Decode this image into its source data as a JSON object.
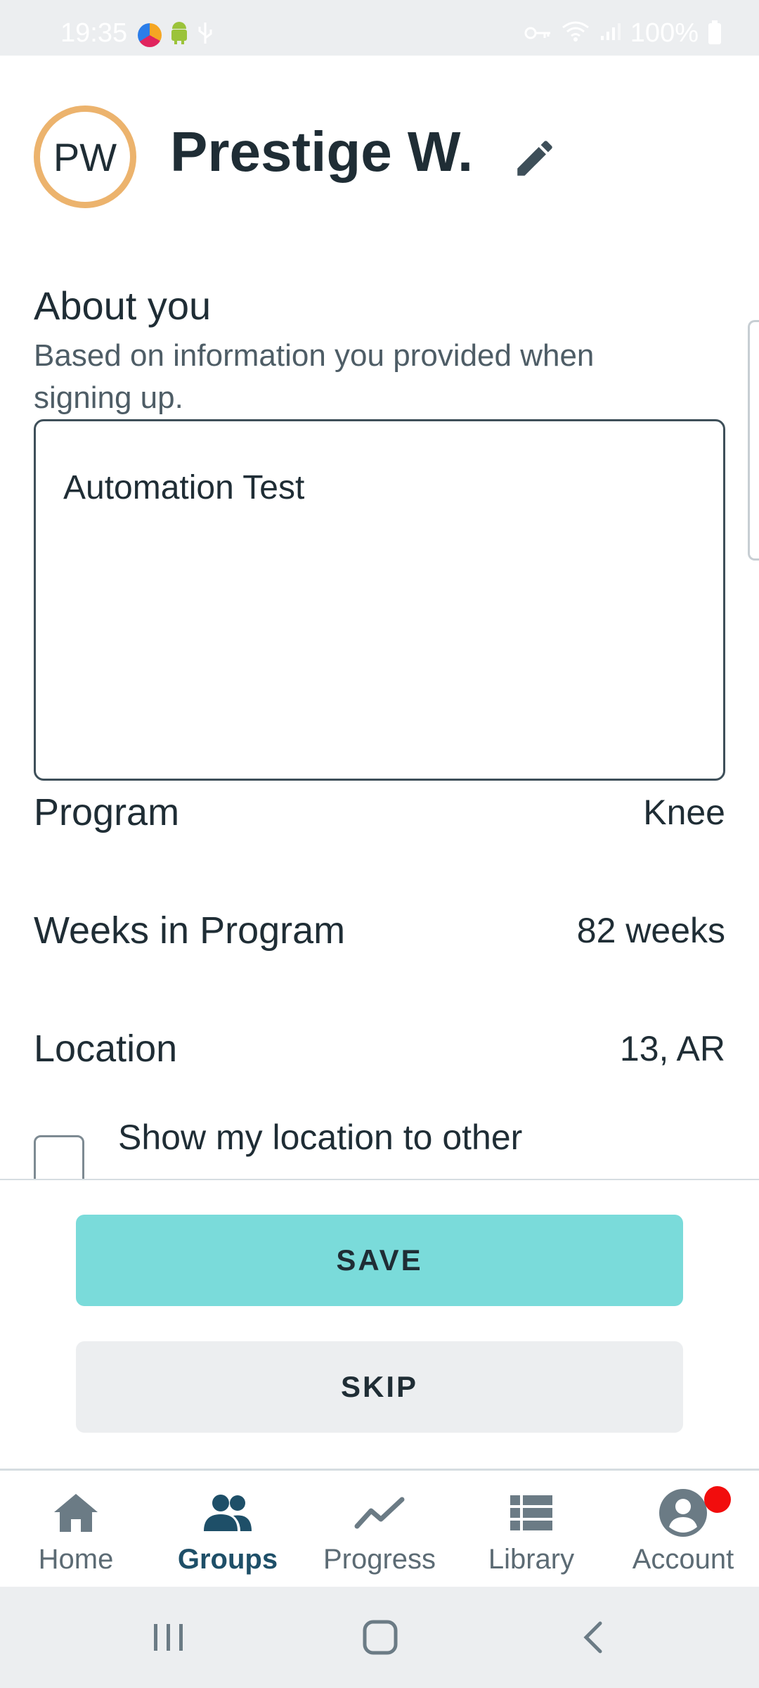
{
  "status_bar": {
    "time": "19:35",
    "battery": "100%"
  },
  "profile": {
    "initials": "PW",
    "name": "Prestige W."
  },
  "about": {
    "title": "About you",
    "subtitle": "Based on information you provided when signing up.",
    "text": "Automation Test"
  },
  "details": {
    "program_label": "Program",
    "program_value": "Knee",
    "weeks_label": "Weeks in Program",
    "weeks_value": "82 weeks",
    "location_label": "Location",
    "location_value": "13, AR",
    "show_location_label": "Show my location to other",
    "show_location_checked": false
  },
  "actions": {
    "save_label": "SAVE",
    "skip_label": "SKIP"
  },
  "bottom_nav": {
    "items": [
      {
        "label": "Home",
        "icon": "home-icon"
      },
      {
        "label": "Groups",
        "icon": "groups-icon",
        "active": true
      },
      {
        "label": "Progress",
        "icon": "progress-icon"
      },
      {
        "label": "Library",
        "icon": "library-icon"
      },
      {
        "label": "Account",
        "icon": "account-icon",
        "badge": true
      }
    ]
  },
  "colors": {
    "accent": "#7adbda",
    "avatar_ring": "#ecb36d",
    "active_nav": "#1e4f68",
    "badge": "#f20d0d"
  }
}
